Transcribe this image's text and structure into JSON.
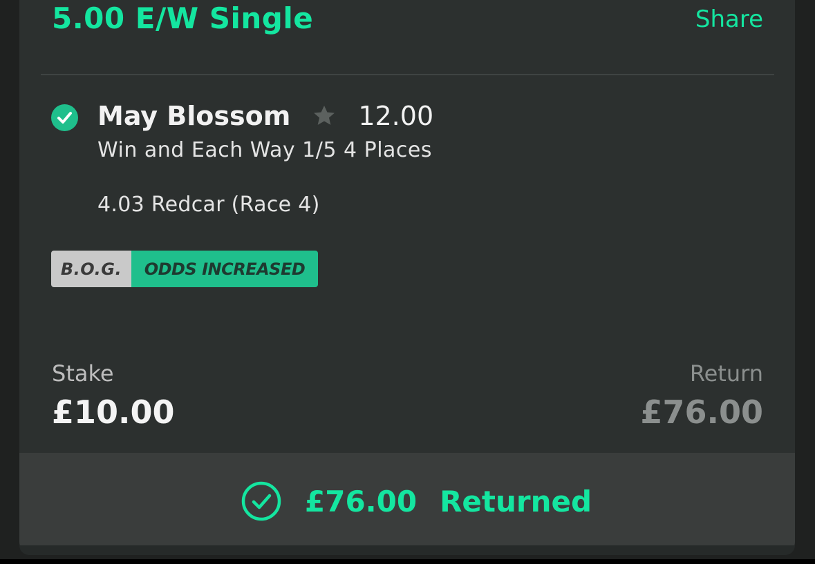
{
  "bet": {
    "title": "5.00 E/W Single",
    "share_label": "Share"
  },
  "selection": {
    "status_icon": "check-circle-icon",
    "name": "May Blossom",
    "favourite_icon": "star-icon",
    "odds": "12.00",
    "market": "Win and Each Way 1/5 4 Places",
    "event": "4.03 Redcar (Race 4)"
  },
  "badges": {
    "bog": "B.O.G.",
    "odds_increased": "ODDS INCREASED"
  },
  "stake": {
    "label": "Stake",
    "value": "£10.00"
  },
  "return": {
    "label": "Return",
    "value": "£76.00"
  },
  "result": {
    "icon": "check-circle-outline-icon",
    "amount": "£76.00",
    "label": "Returned"
  },
  "colors": {
    "accent": "#14e6a0",
    "badge_green": "#1fbf8c",
    "card_background": "#2c302f",
    "returned_bar": "#3a3d3c"
  }
}
